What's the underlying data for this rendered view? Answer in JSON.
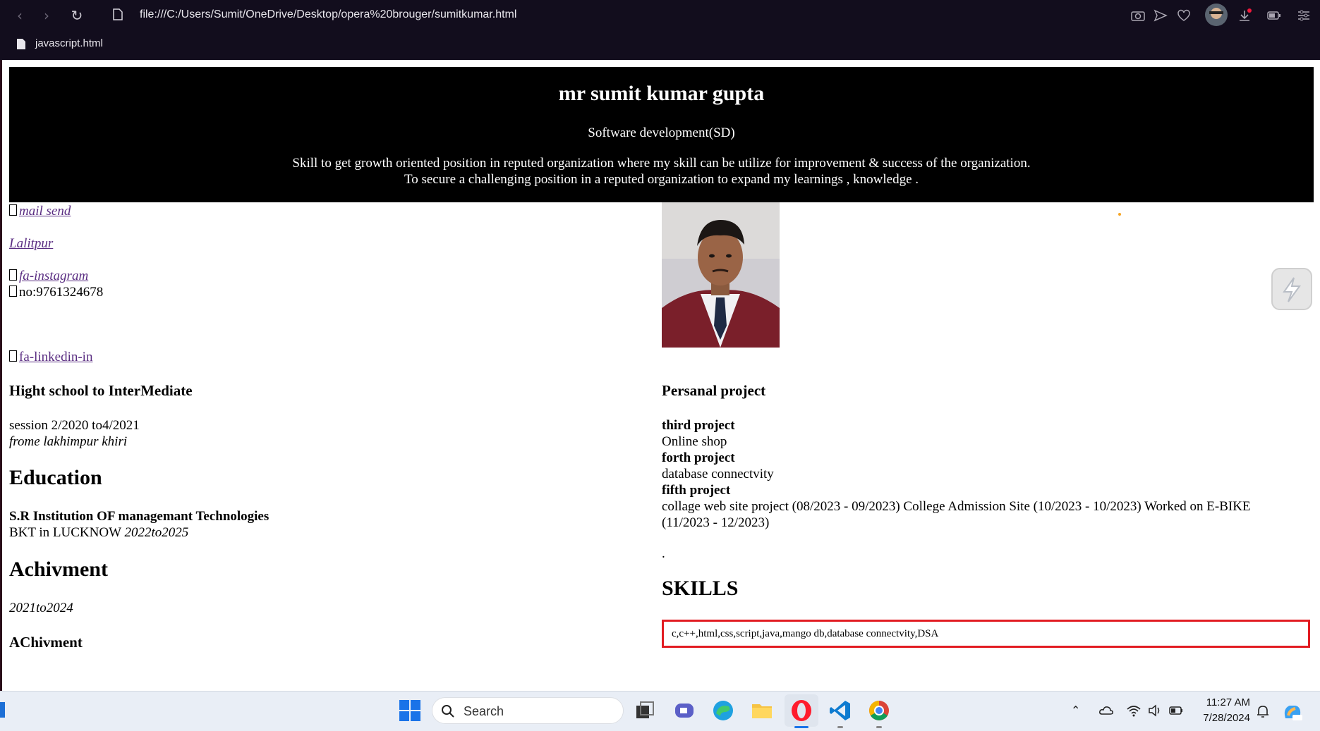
{
  "browser": {
    "url": "file:///C:/Users/Sumit/OneDrive/Desktop/opera%20brouger/sumitkumar.html",
    "bookmark_label": "javascript.html"
  },
  "header": {
    "name": "mr sumit kumar gupta",
    "role": "Software development(SD)",
    "objective_line1": "Skill to get growth oriented position in reputed organization where my skill can be utilize for improvement & success of the organization.",
    "objective_line2": "To secure a challenging position in a reputed organization to expand my learnings , knowledge ."
  },
  "contact": {
    "mail": "mail send",
    "location": "Lalitpur",
    "instagram": "fa-instagram",
    "phone": "no:9761324678",
    "linkedin": "fa-linkedin-in"
  },
  "school": {
    "heading": "Hight school to InterMediate",
    "session": "session 2/2020 to4/2021",
    "from": "frome lakhimpur khiri"
  },
  "education": {
    "heading": "Education",
    "institution": "S.R Institution OF managemant Technologies",
    "course": "BKT in LUCKNOW",
    "years": "2022to2025"
  },
  "achievement": {
    "heading": "Achivment",
    "years": "2021to2024",
    "subheading": "AChivment"
  },
  "projects": {
    "heading": "Persanal project",
    "items": [
      {
        "title": "third project",
        "desc": "Online shop"
      },
      {
        "title": "forth project",
        "desc": "database connectvity"
      },
      {
        "title": "fifth project",
        "desc_line1": "collage web site project (08/2023 - 09/2023) College Admission Site (10/2023 - 10/2023) Worked on E-BIKE",
        "desc_line2": "(11/2023 - 12/2023)"
      }
    ],
    "dot": "."
  },
  "skills": {
    "heading": "SKILLS",
    "list": "c,c++,html,css,script,java,mango db,database connectvity,DSA"
  },
  "taskbar": {
    "search_label": "Search",
    "time": "11:27 AM",
    "date": "7/28/2024"
  },
  "colors": {
    "chrome_bg": "#120d1d",
    "header_bg": "#000000",
    "link": "#5a2d82",
    "skills_border": "#e21c22",
    "taskbar_bg": "#e9eef6"
  }
}
